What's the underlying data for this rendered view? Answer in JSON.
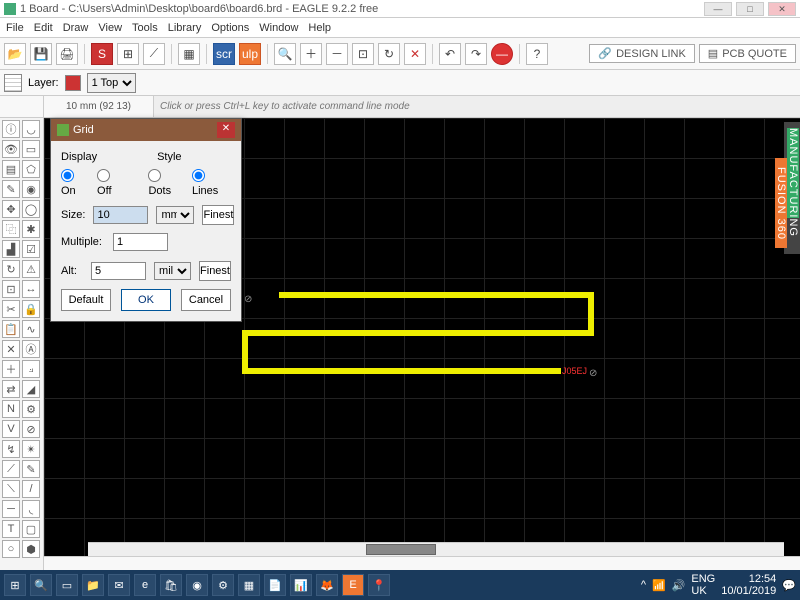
{
  "title": "1 Board - C:\\Users\\Admin\\Desktop\\board6\\board6.brd - EAGLE 9.2.2 free",
  "menu": {
    "items": [
      "File",
      "Edit",
      "Draw",
      "View",
      "Tools",
      "Library",
      "Options",
      "Window",
      "Help"
    ]
  },
  "toolbar1": {
    "design_link": "DESIGN LINK",
    "pcb_quote": "PCB QUOTE"
  },
  "layerbar": {
    "layer_label": "Layer:",
    "layer_value": "1 Top"
  },
  "coords": "10 mm (92 13)",
  "cmdline_placeholder": "Click or press Ctrl+L key to activate command line mode",
  "dialog": {
    "title": "Grid",
    "display_label": "Display",
    "style_label": "Style",
    "on": "On",
    "off": "Off",
    "dots": "Dots",
    "lines": "Lines",
    "size_label": "Size:",
    "size_value": "10",
    "size_unit": "mm",
    "finest": "Finest",
    "multiple_label": "Multiple:",
    "multiple_value": "1",
    "alt_label": "Alt:",
    "alt_value": "5",
    "alt_unit": "mil",
    "default": "Default",
    "ok": "OK",
    "cancel": "Cancel"
  },
  "sidepanel": {
    "p1": "MANUFACTURING",
    "p2": "FUSION 360"
  },
  "canvas": {
    "text": "J05EJ"
  },
  "taskbar": {
    "lang": "ENG",
    "kb": "UK",
    "time": "12:54",
    "date": "10/01/2019"
  },
  "chart_data": null
}
